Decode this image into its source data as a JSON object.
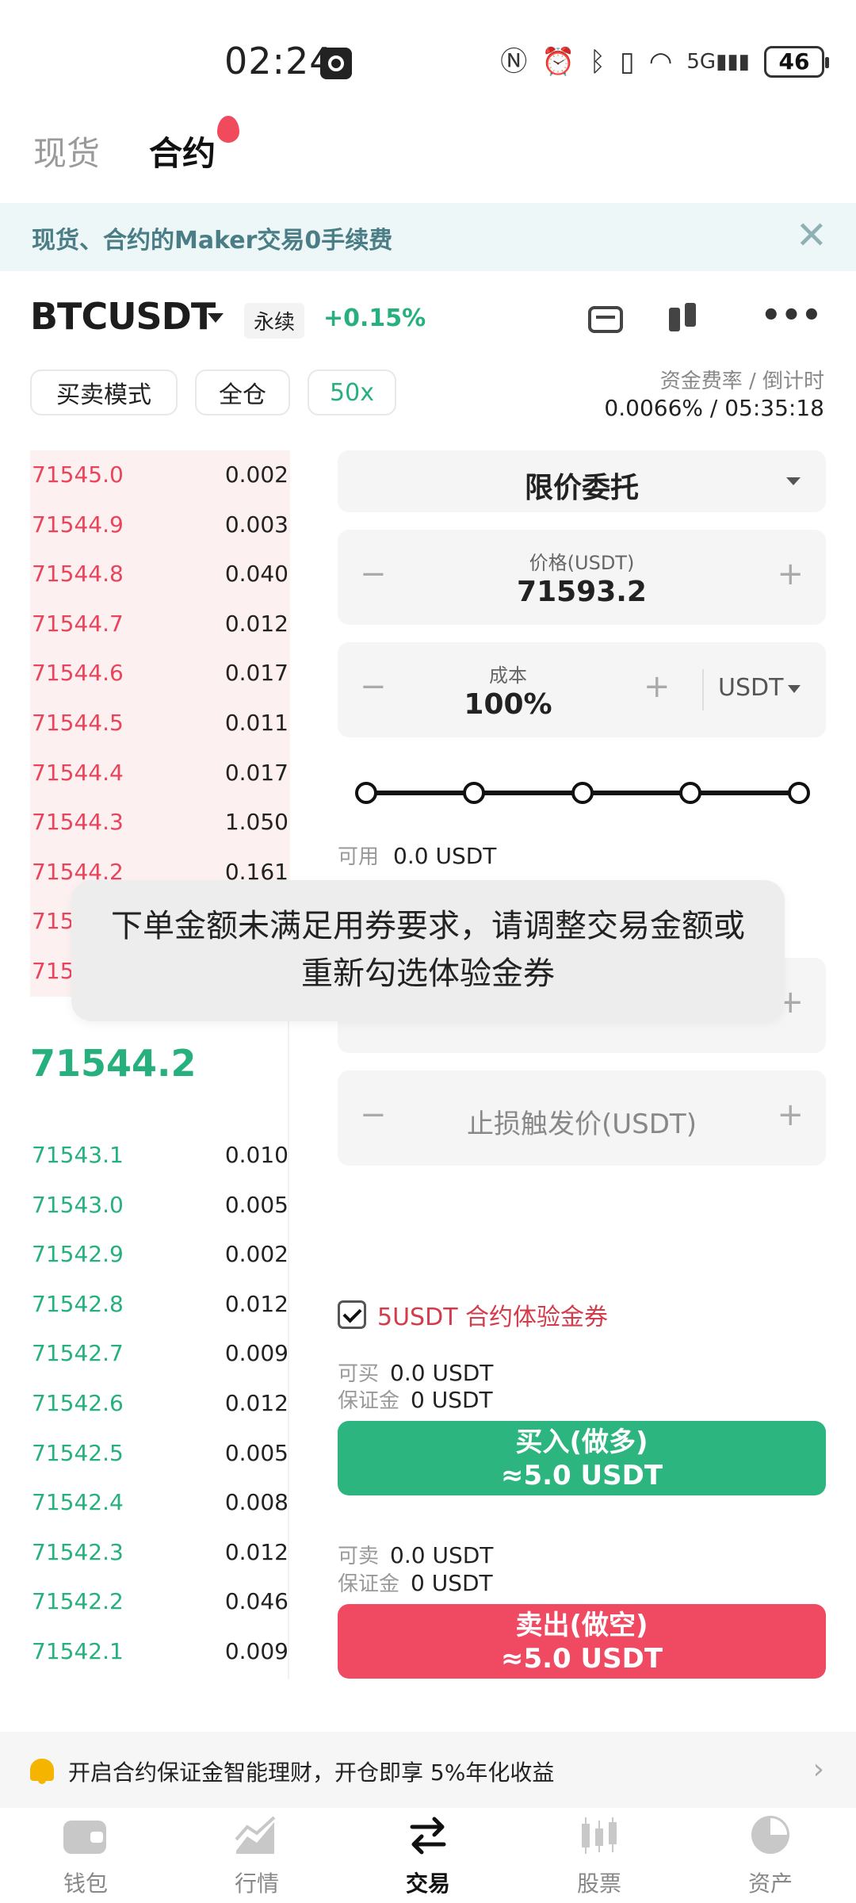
{
  "status_bar": {
    "time": "02:24",
    "battery": "46",
    "network": "5G"
  },
  "top_tabs": [
    {
      "label": "现货"
    },
    {
      "label": "合约"
    }
  ],
  "banner": {
    "text": "现货、合约的Maker交易0手续费",
    "close": "✕"
  },
  "symbol": {
    "name": "BTCUSDT",
    "type_badge": "永续",
    "change": "+0.15%"
  },
  "pills": {
    "mode": "买卖模式",
    "margin": "全仓",
    "leverage": "50x"
  },
  "funding": {
    "label": "资金费率 / 倒计时",
    "value": "0.0066% / 05:35:18"
  },
  "order_book": {
    "asks": [
      {
        "price": "71545.0",
        "qty": "0.002"
      },
      {
        "price": "71544.9",
        "qty": "0.003"
      },
      {
        "price": "71544.8",
        "qty": "0.040"
      },
      {
        "price": "71544.7",
        "qty": "0.012"
      },
      {
        "price": "71544.6",
        "qty": "0.017"
      },
      {
        "price": "71544.5",
        "qty": "0.011"
      },
      {
        "price": "71544.4",
        "qty": "0.017"
      },
      {
        "price": "71544.3",
        "qty": "1.050"
      },
      {
        "price": "71544.2",
        "qty": "0.161"
      },
      {
        "price": "715",
        "qty": ""
      },
      {
        "price": "715",
        "qty": ""
      }
    ],
    "mid_price": "71544.2",
    "bids": [
      {
        "price": "71543.1",
        "qty": "0.010"
      },
      {
        "price": "71543.0",
        "qty": "0.005"
      },
      {
        "price": "71542.9",
        "qty": "0.002"
      },
      {
        "price": "71542.8",
        "qty": "0.012"
      },
      {
        "price": "71542.7",
        "qty": "0.009"
      },
      {
        "price": "71542.6",
        "qty": "0.012"
      },
      {
        "price": "71542.5",
        "qty": "0.005"
      },
      {
        "price": "71542.4",
        "qty": "0.008"
      },
      {
        "price": "71542.3",
        "qty": "0.012"
      },
      {
        "price": "71542.2",
        "qty": "0.046"
      },
      {
        "price": "71542.1",
        "qty": "0.009"
      }
    ]
  },
  "order_form": {
    "order_type": "限价委托",
    "price": {
      "label": "价格(USDT)",
      "value": "71593.2",
      "minus": "−",
      "plus": "+"
    },
    "cost": {
      "label": "成本",
      "value": "100%",
      "unit": "USDT",
      "minus": "−",
      "plus": "+"
    },
    "slider_percent": 100,
    "available": {
      "label": "可用",
      "value": "0.0 USDT"
    },
    "take_profit": {
      "minus": "−",
      "plus": "+"
    },
    "stop_loss": {
      "label": "止损触发价(USDT)",
      "minus": "−",
      "plus": "+"
    },
    "coupon": {
      "label": "5USDT 合约体验金券",
      "checked": true
    },
    "buy_info": {
      "can_buy_label": "可买",
      "can_buy_value": "0.0 USDT",
      "margin_label": "保证金",
      "margin_value": "0 USDT"
    },
    "buy_button": {
      "line1": "买入(做多)",
      "line2": "≈5.0 USDT"
    },
    "sell_info": {
      "can_sell_label": "可卖",
      "can_sell_value": "0.0 USDT",
      "margin_label": "保证金",
      "margin_value": "0 USDT"
    },
    "sell_button": {
      "line1": "卖出(做空)",
      "line2": "≈5.0 USDT"
    }
  },
  "toast": {
    "text": "下单金额未满足用券要求，请调整交易金额或重新勾选体验金券"
  },
  "promo": {
    "text": "开启合约保证金智能理财，开仓即享 5%年化收益",
    "arrow": "›"
  },
  "bottom_nav": [
    {
      "label": "钱包",
      "icon": "wallet-icon"
    },
    {
      "label": "行情",
      "icon": "market-icon"
    },
    {
      "label": "交易",
      "icon": "trade-icon"
    },
    {
      "label": "股票",
      "icon": "stocks-icon"
    },
    {
      "label": "资产",
      "icon": "assets-icon"
    }
  ],
  "colors": {
    "up": "#26b07d",
    "down": "#e8455c",
    "buy": "#2db57f",
    "sell": "#f04a63"
  }
}
